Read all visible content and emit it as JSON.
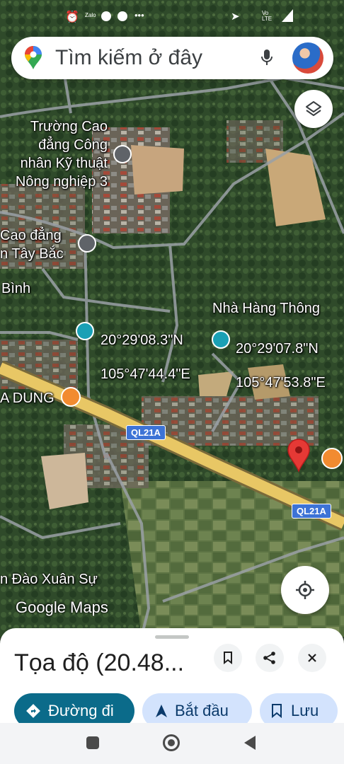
{
  "status_bar": {
    "icons": [
      "alarm-icon",
      "zalo-icon",
      "facebook-icon",
      "facebook-icon",
      "more-dots-icon",
      "location-arrow-icon",
      "volte-icon",
      "signal-icon"
    ],
    "volte_label": "Vo LTE",
    "zalo_label": "Zalo",
    "more_label": "•••"
  },
  "search": {
    "placeholder": "Tìm kiếm ở đây",
    "icons": [
      "google-maps-pin-icon",
      "microphone-icon"
    ]
  },
  "map": {
    "labels": {
      "truong_cao_dang": "Trường Cao\nđẳng Công\nnhân Kỹ thuật\nNông nghiệp 3",
      "cao_dang_tay_bac": "Cao đẳng\nn Tây Bắc",
      "binh": "Bình",
      "nha_hang_thong": "Nhà Hàng Thông",
      "a_dung": "A DUNG",
      "dao_xuan_su": "n Đào Xuân Sự"
    },
    "coords": [
      {
        "lat": "20°29'08.3\"N",
        "lng": "105°47'44.4\"E"
      },
      {
        "lat": "20°29'07.8\"N",
        "lng": "105°47'53.8\"E"
      }
    ],
    "road_shields": [
      "QL21A",
      "QL21A"
    ],
    "watermark": "Google Maps",
    "colors": {
      "road": "#e8c765",
      "pin": "#e53935",
      "bookmark_pin": "#1aa0b5",
      "bar_pin": "#f28b30"
    }
  },
  "sheet": {
    "title": "Tọa độ (20.48...",
    "buttons": {
      "directions": "Đường đi",
      "start": "Bắt đầu",
      "save": "Lưu"
    },
    "colors": {
      "primary": "#0b57d0",
      "tonal": "#d3e3fd",
      "directions_bg": "#0b6b8a"
    }
  },
  "nav": {
    "icons": [
      "recents-square-icon",
      "home-circle-icon",
      "back-triangle-icon"
    ]
  }
}
